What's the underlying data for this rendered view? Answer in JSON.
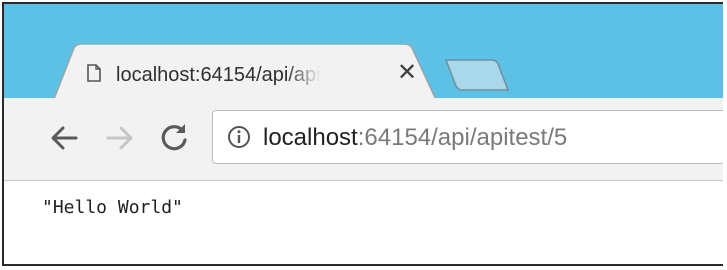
{
  "tab": {
    "title": "localhost:64154/api/apite",
    "close_glyph": "✕",
    "favicon": "page-icon"
  },
  "toolbar": {
    "back_icon": "back-arrow-icon",
    "forward_icon": "forward-arrow-icon",
    "reload_icon": "reload-icon",
    "info_icon": "info-icon"
  },
  "address": {
    "host": "localhost",
    "rest": ":64154/api/apitest/5"
  },
  "page": {
    "response_text": "\"Hello World\""
  },
  "colors": {
    "titlebar": "#5dc1e6",
    "toolbar": "#f2f2f2",
    "url_dim": "#7a7a7a"
  }
}
